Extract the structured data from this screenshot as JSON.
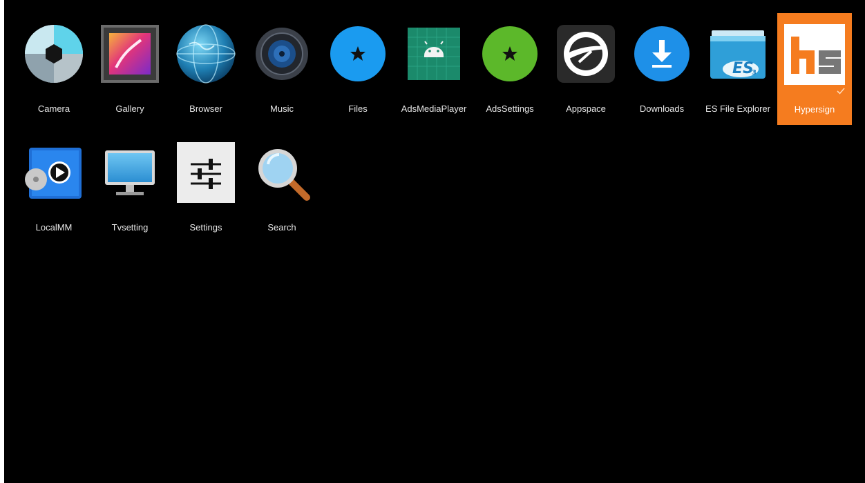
{
  "launcher": {
    "apps": [
      {
        "label": "Camera",
        "icon": "camera-icon"
      },
      {
        "label": "Gallery",
        "icon": "gallery-icon"
      },
      {
        "label": "Browser",
        "icon": "browser-globe-icon"
      },
      {
        "label": "Music",
        "icon": "music-speaker-icon"
      },
      {
        "label": "Files",
        "icon": "star-icon"
      },
      {
        "label": "AdsMediaPlayer",
        "icon": "android-icon"
      },
      {
        "label": "AdsSettings",
        "icon": "star-icon"
      },
      {
        "label": "Appspace",
        "icon": "appspace-icon"
      },
      {
        "label": "Downloads",
        "icon": "download-icon"
      },
      {
        "label": "ES File Explorer",
        "icon": "es-file-explorer-icon"
      },
      {
        "label": "Hypersign",
        "icon": "hypersign-icon",
        "selected": true
      },
      {
        "label": "LocalMM",
        "icon": "localmm-play-icon"
      },
      {
        "label": "Tvsetting",
        "icon": "tv-monitor-icon"
      },
      {
        "label": "Settings",
        "icon": "sliders-icon"
      },
      {
        "label": "Search",
        "icon": "magnifier-icon"
      }
    ]
  },
  "colors": {
    "background": "#000000",
    "focus_highlight": "#f57c1f",
    "files_blue": "#1a9bf0",
    "adssettings_green": "#5cb82a",
    "android_teal": "#1b8a6b"
  }
}
